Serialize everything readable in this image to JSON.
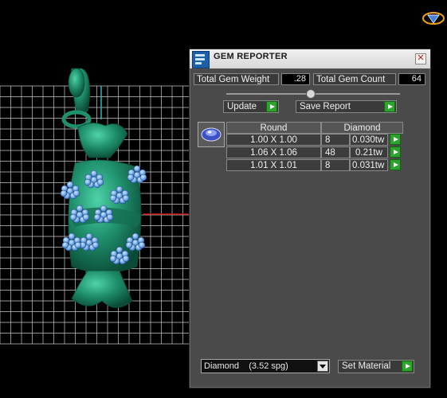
{
  "panel": {
    "title": "GEM REPORTER",
    "close_glyph": "✕",
    "total_weight_label": "Total Gem Weight",
    "total_weight_value": ".28",
    "total_count_label": "Total Gem Count",
    "total_count_value": "64",
    "update_label": "Update",
    "save_report_label": "Save Report"
  },
  "gem_table": {
    "headers": [
      "Round",
      "Diamond"
    ],
    "rows": [
      {
        "size": "1.00 X 1.00",
        "count": "8",
        "weight": "0.030tw"
      },
      {
        "size": "1.06 X 1.06",
        "count": "48",
        "weight": "0.21tw"
      },
      {
        "size": "1.01 X 1.01",
        "count": "8",
        "weight": "0.031tw"
      }
    ]
  },
  "material": {
    "selected": "Diamond    (3.52 spg)",
    "set_material_label": "Set Material"
  },
  "colors": {
    "pendant_green": "#1f8f6c",
    "gem_blue": "#6fa8e8",
    "grid_line": "#c8c8c8",
    "button_green": "#2ea32e"
  },
  "icons": {
    "top_right": "gem-logo-icon",
    "app": "gem-reporter-app-icon",
    "gem_shape": "round-gem-icon"
  }
}
